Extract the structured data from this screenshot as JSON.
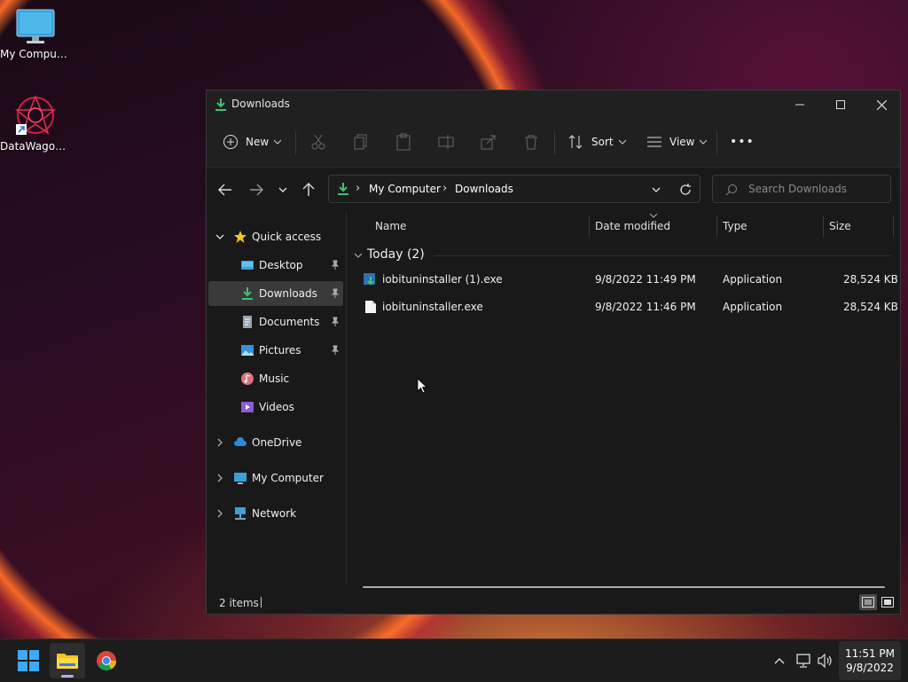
{
  "desktop": {
    "icons": [
      {
        "label": "My Computer"
      },
      {
        "label": "DataWagon..."
      }
    ]
  },
  "window": {
    "title": "Downloads",
    "controls": {
      "minimize": "—",
      "maximize": "☐",
      "close": "✕"
    }
  },
  "toolbar": {
    "new_label": "New",
    "sort_label": "Sort",
    "view_label": "View",
    "more_label": "•••"
  },
  "address": {
    "crumbs": [
      "My Computer",
      "Downloads"
    ],
    "separator": "›"
  },
  "search": {
    "placeholder": "Search Downloads"
  },
  "nav": {
    "quick_access": "Quick access",
    "items": [
      {
        "label": "Desktop",
        "pinned": true
      },
      {
        "label": "Downloads",
        "pinned": true,
        "selected": true
      },
      {
        "label": "Documents",
        "pinned": true
      },
      {
        "label": "Pictures",
        "pinned": true
      },
      {
        "label": "Music",
        "pinned": false
      },
      {
        "label": "Videos",
        "pinned": false
      }
    ],
    "roots": [
      {
        "label": "OneDrive"
      },
      {
        "label": "My Computer"
      },
      {
        "label": "Network"
      }
    ]
  },
  "columns": {
    "name": "Name",
    "date": "Date modified",
    "type": "Type",
    "size": "Size"
  },
  "group": {
    "label": "Today (2)"
  },
  "files": [
    {
      "name": "iobituninstaller (1).exe",
      "date": "9/8/2022 11:49 PM",
      "type": "Application",
      "size": "28,524 KB"
    },
    {
      "name": "iobituninstaller.exe",
      "date": "9/8/2022 11:46 PM",
      "type": "Application",
      "size": "28,524 KB"
    }
  ],
  "status": {
    "count": "2 items"
  },
  "taskbar": {
    "time": "11:51 PM",
    "date": "9/8/2022"
  },
  "colors": {
    "accent": "#60cdff",
    "download_green": "#3ec46d"
  }
}
